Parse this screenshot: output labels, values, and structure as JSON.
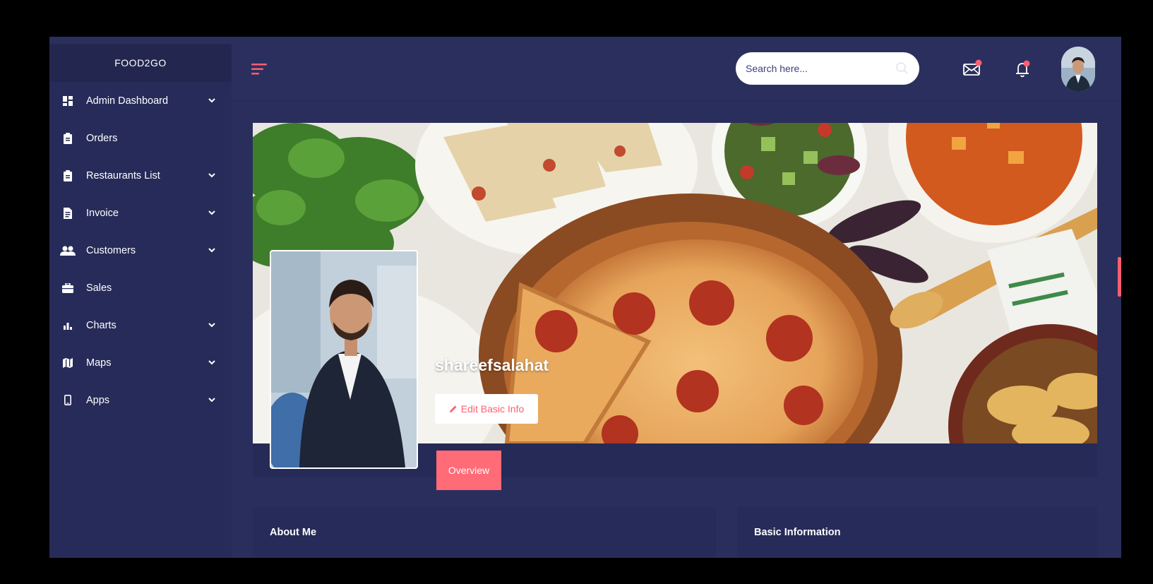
{
  "brand": "FOOD2GO",
  "sidebar": {
    "items": [
      {
        "label": "Admin Dashboard",
        "icon": "dashboard-icon",
        "has_chevron": true
      },
      {
        "label": "Orders",
        "icon": "clipboard-icon",
        "has_chevron": false
      },
      {
        "label": "Restaurants List",
        "icon": "clipboard-icon",
        "has_chevron": true
      },
      {
        "label": "Invoice",
        "icon": "document-icon",
        "has_chevron": true
      },
      {
        "label": "Customers",
        "icon": "users-icon",
        "has_chevron": true
      },
      {
        "label": "Sales",
        "icon": "briefcase-icon",
        "has_chevron": false
      },
      {
        "label": "Charts",
        "icon": "bar-chart-icon",
        "has_chevron": true
      },
      {
        "label": "Maps",
        "icon": "map-icon",
        "has_chevron": true
      },
      {
        "label": "Apps",
        "icon": "mobile-icon",
        "has_chevron": true
      }
    ]
  },
  "header": {
    "search_placeholder": "Search here...",
    "icons": [
      "menu-icon",
      "mail-icon",
      "bell-icon",
      "avatar"
    ]
  },
  "profile": {
    "name": "shareefsalahat",
    "edit_label": "Edit Basic Info",
    "tab_overview": "Overview"
  },
  "panels": {
    "about_title": "About Me",
    "basic_info_title": "Basic Information"
  },
  "colors": {
    "accent": "#ff6b77",
    "sidebar_bg": "#272b59",
    "content_bg": "#2a2e5c"
  }
}
